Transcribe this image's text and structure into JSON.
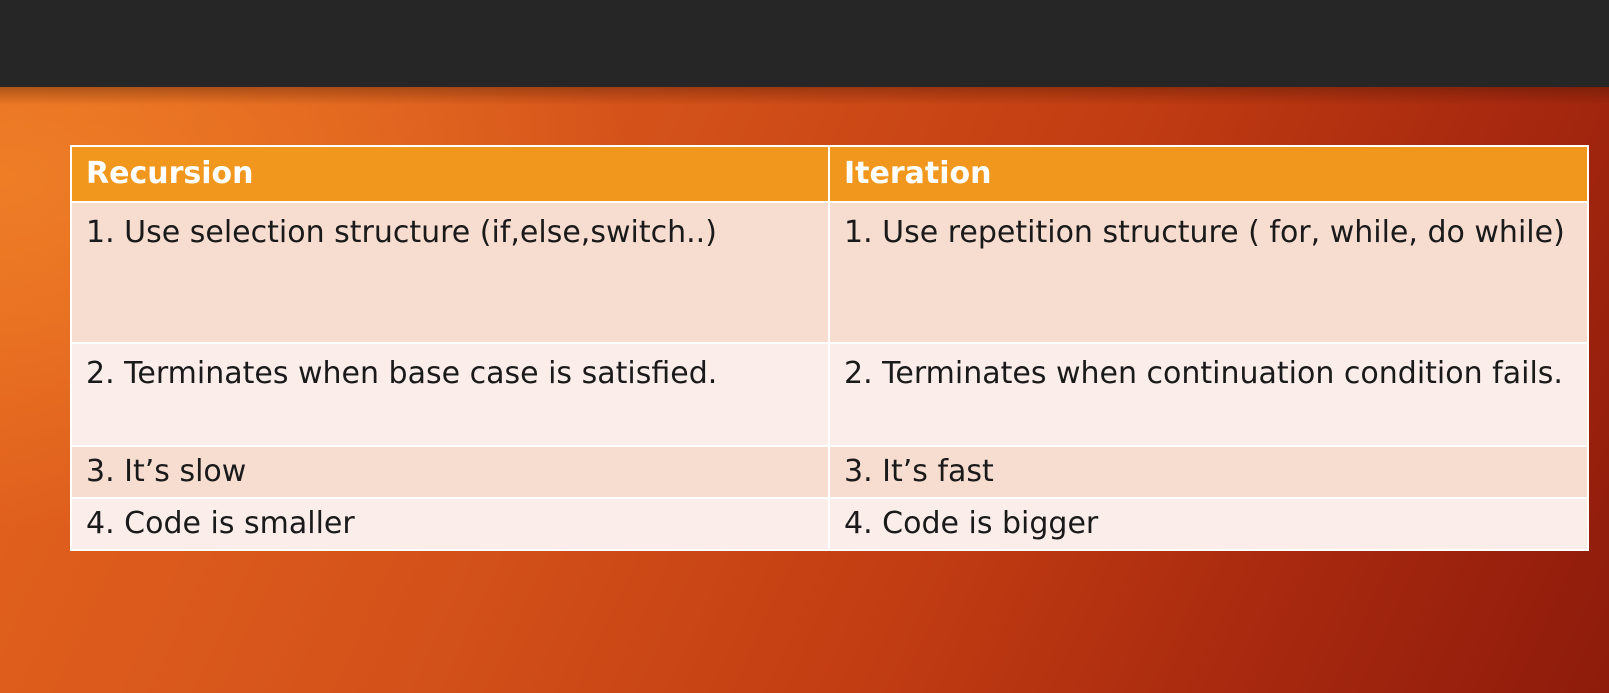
{
  "table": {
    "headers": [
      "Recursion",
      "Iteration"
    ],
    "rows": [
      [
        "1. Use selection structure (if,else,switch..)",
        "1. Use repetition structure ( for, while, do while)"
      ],
      [
        "2. Terminates when base case is satisfied.",
        "2. Terminates when continuation condition fails."
      ],
      [
        "3. It’s slow",
        "3. It’s fast"
      ],
      [
        "4. Code is smaller",
        "4. Code is bigger"
      ]
    ]
  },
  "colors": {
    "top_bar": "#262626",
    "header_bg": "#f2971e",
    "row_odd_bg": "#f7dcd0",
    "row_even_bg": "#fbeeea",
    "slide_orange": "#e5651e",
    "slide_red": "#8e1b0b"
  }
}
